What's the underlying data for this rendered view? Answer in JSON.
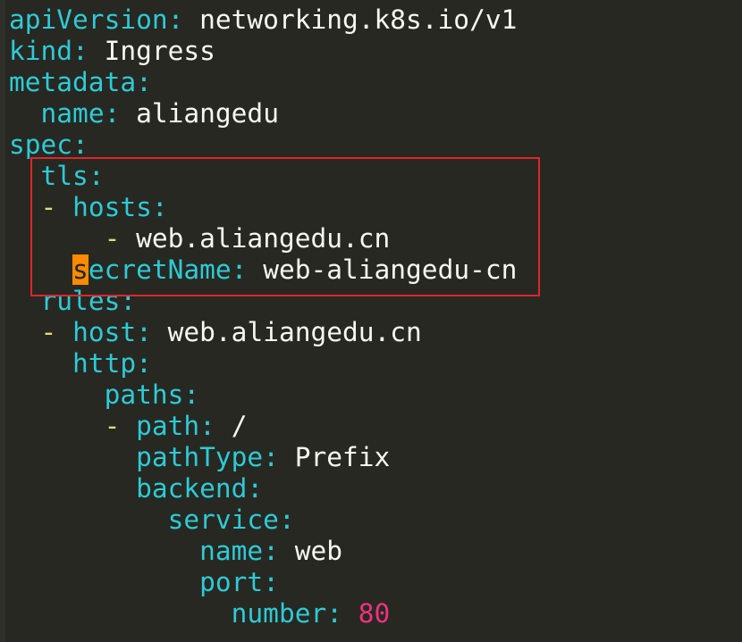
{
  "lines": [
    {
      "indent": "",
      "dash": "",
      "key": "apiVersion",
      "sep": ": ",
      "value": "networking.k8s.io/v1"
    },
    {
      "indent": "",
      "dash": "",
      "key": "kind",
      "sep": ": ",
      "value": "Ingress"
    },
    {
      "indent": "",
      "dash": "",
      "key": "metadata",
      "sep": ":",
      "value": ""
    },
    {
      "indent": "  ",
      "dash": "",
      "key": "name",
      "sep": ": ",
      "value": "aliangedu"
    },
    {
      "indent": "",
      "dash": "",
      "key": "spec",
      "sep": ":",
      "value": ""
    },
    {
      "indent": "  ",
      "dash": "",
      "key": "tls",
      "sep": ":",
      "value": ""
    },
    {
      "indent": "  ",
      "dash": "- ",
      "key": "hosts",
      "sep": ":",
      "value": ""
    },
    {
      "indent": "      ",
      "dash": "- ",
      "key": "",
      "sep": "",
      "value": "web.aliangedu.cn"
    },
    {
      "indent": "    ",
      "dash": "",
      "cursor_char": "s",
      "key": "ecretName",
      "sep": ": ",
      "value": "web-aliangedu-cn"
    },
    {
      "indent": "  ",
      "dash": "",
      "key": "rules",
      "sep": ":",
      "value": ""
    },
    {
      "indent": "  ",
      "dash": "- ",
      "key": "host",
      "sep": ": ",
      "value": "web.aliangedu.cn"
    },
    {
      "indent": "    ",
      "dash": "",
      "key": "http",
      "sep": ":",
      "value": ""
    },
    {
      "indent": "      ",
      "dash": "",
      "key": "paths",
      "sep": ":",
      "value": ""
    },
    {
      "indent": "      ",
      "dash": "- ",
      "key": "path",
      "sep": ": ",
      "value": "/"
    },
    {
      "indent": "        ",
      "dash": "",
      "key": "pathType",
      "sep": ": ",
      "value": "Prefix"
    },
    {
      "indent": "        ",
      "dash": "",
      "key": "backend",
      "sep": ":",
      "value": ""
    },
    {
      "indent": "          ",
      "dash": "",
      "key": "service",
      "sep": ":",
      "value": ""
    },
    {
      "indent": "            ",
      "dash": "",
      "key": "name",
      "sep": ": ",
      "value": "web"
    },
    {
      "indent": "            ",
      "dash": "",
      "key": "port",
      "sep": ":",
      "value": ""
    },
    {
      "indent": "              ",
      "dash": "",
      "key": "number",
      "sep": ": ",
      "value": "80",
      "numeric": true
    }
  ],
  "colors": {
    "background": "#272822",
    "key": "#2ecad6",
    "dash": "#e6db74",
    "value": "#f8f8f2",
    "number": "#f0317e",
    "cursor": "#ff8a00",
    "highlight_box": "#e0252b"
  }
}
